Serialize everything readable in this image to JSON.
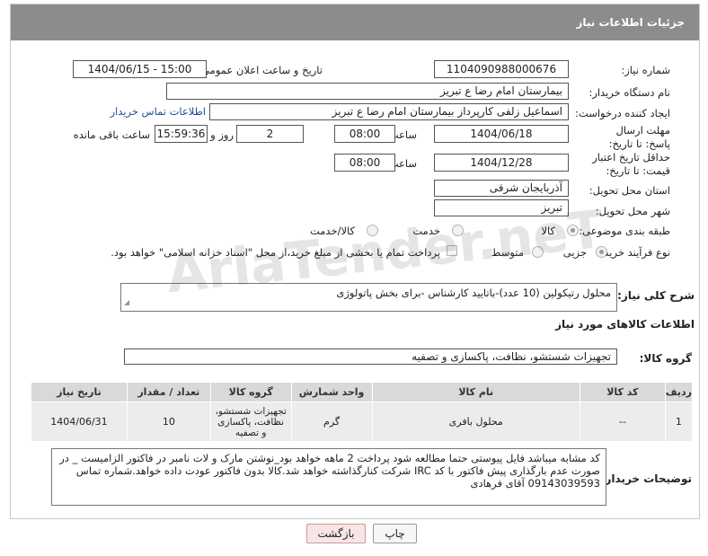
{
  "header": {
    "title": "جزئیات اطلاعات نیاز"
  },
  "labels": {
    "need_number": "شماره نیاز:",
    "announce_datetime": "تاریخ و ساعت اعلان عمومی:",
    "buyer_org": "نام دستگاه خریدار:",
    "requester": "ایجاد کننده درخواست:",
    "buyer_contact_link": "اطلاعات تماس خریدار",
    "reply_deadline": "مهلت ارسال پاسخ: تا تاریخ:",
    "hour": "ساعت",
    "day_and": "روز و",
    "hours_remaining": "ساعت باقی مانده",
    "price_validity": "حداقل تاریخ اعتبار قیمت: تا تاریخ:",
    "delivery_province": "استان محل تحویل:",
    "delivery_city": "شهر محل تحویل:",
    "category": "طبقه بندی موضوعی:",
    "process_type": "نوع فرآیند خرید :",
    "description": "شرح کلی نیاز:",
    "goods_info": "اطلاعات کالاهای مورد نیاز",
    "goods_group": "گروه کالا:",
    "buyer_notes": "توضیحات خریدار:"
  },
  "fields": {
    "need_number": "1104090988000676",
    "announce_datetime": "1404/06/15 - 15:00",
    "buyer_org": "بیمارستان امام رضا  ع  تبریز",
    "requester": "اسماعیل زلفی کارپرداز بیمارستان امام رضا  ع  تبریز",
    "reply_date": "1404/06/18",
    "reply_time": "08:00",
    "days_remaining": "2",
    "time_remaining": "15:59:36",
    "validity_date": "1404/12/28",
    "validity_time": "08:00",
    "province": "آذربایجان شرقی",
    "city": "تبریز",
    "description": "محلول رتیکولین (10 عدد)-باتایید کارشناس -برای بخش پاتولوژی",
    "goods_group": "تجهیزات شستشو، نظافت، پاکسازی و تصفیه",
    "buyer_notes": "کد مشابه میباشد فایل پیوستی حتما مطالعه شود  پرداخت 2 ماهه خواهد بود_نوشتن مارک و لات نامبر در فاکتور الزامیست _  در صورت عدم بارگذاری پیش فاکتور با کد IRC  شرکت کنارگذاشته خواهد شد.کالا بدون فاکتور عودت داده خواهد.شماره تماس 09143039593 آقای فرهادی"
  },
  "category_options": [
    {
      "label": "کالا",
      "selected": true
    },
    {
      "label": "خدمت",
      "selected": false
    },
    {
      "label": "کالا/خدمت",
      "selected": false
    }
  ],
  "process_options": [
    {
      "label": "جزیی",
      "selected": true
    },
    {
      "label": "متوسط",
      "selected": false
    }
  ],
  "payment_note": "پرداخت تمام یا بخشی از مبلغ خرید،از محل \"اسناد خزانه اسلامی\" خواهد بود.",
  "table": {
    "headers": [
      "ردیف",
      "کد کالا",
      "نام کالا",
      "واحد شمارش",
      "گروه کالا",
      "تعداد / مقدار",
      "تاریخ نیاز"
    ],
    "rows": [
      [
        "1",
        "--",
        "محلول بافری",
        "گرم",
        "تجهیزات شستشو، نظافت، پاکسازی و تصفیه",
        "10",
        "1404/06/31"
      ]
    ]
  },
  "buttons": {
    "print": "چاپ",
    "back": "بازگشت"
  },
  "watermark": "AriaTender.neT"
}
